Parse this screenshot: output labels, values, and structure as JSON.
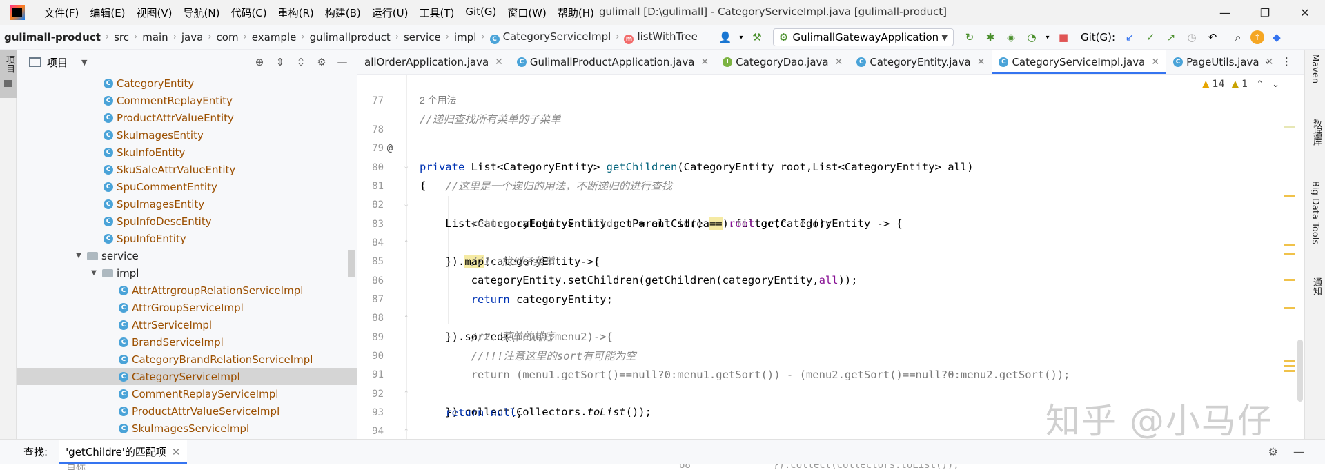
{
  "titlebar": {
    "menu": [
      "文件(F)",
      "编辑(E)",
      "视图(V)",
      "导航(N)",
      "代码(C)",
      "重构(R)",
      "构建(B)",
      "运行(U)",
      "工具(T)",
      "Git(G)",
      "窗口(W)",
      "帮助(H)"
    ],
    "window_title": "gulimall [D:\\gulimall] - CategoryServiceImpl.java [gulimall-product]",
    "minimize": "—",
    "maximize": "❐",
    "close": "✕"
  },
  "navbar": {
    "breadcrumbs": [
      "gulimall-product",
      "src",
      "main",
      "java",
      "com",
      "example",
      "gulimallproduct",
      "service",
      "impl",
      "CategoryServiceImpl",
      "listWithTree"
    ],
    "run_config": "GulimallGatewayApplication",
    "git_label": "Git(G):"
  },
  "left_strip": {
    "project_tab": "项目"
  },
  "project_panel": {
    "title": "项目",
    "tree": [
      {
        "label": "CategoryEntity",
        "type": "class",
        "indent": 3
      },
      {
        "label": "CommentReplayEntity",
        "type": "class",
        "indent": 3
      },
      {
        "label": "ProductAttrValueEntity",
        "type": "class",
        "indent": 3
      },
      {
        "label": "SkuImagesEntity",
        "type": "class",
        "indent": 3
      },
      {
        "label": "SkuInfoEntity",
        "type": "class",
        "indent": 3
      },
      {
        "label": "SkuSaleAttrValueEntity",
        "type": "class",
        "indent": 3
      },
      {
        "label": "SpuCommentEntity",
        "type": "class",
        "indent": 3
      },
      {
        "label": "SpuImagesEntity",
        "type": "class",
        "indent": 3
      },
      {
        "label": "SpuInfoDescEntity",
        "type": "class",
        "indent": 3
      },
      {
        "label": "SpuInfoEntity",
        "type": "class",
        "indent": 3
      },
      {
        "label": "service",
        "type": "package",
        "indent": 2
      },
      {
        "label": "impl",
        "type": "package",
        "indent": 3
      },
      {
        "label": "AttrAttrgroupRelationServiceImpl",
        "type": "class",
        "indent": 4
      },
      {
        "label": "AttrGroupServiceImpl",
        "type": "class",
        "indent": 4
      },
      {
        "label": "AttrServiceImpl",
        "type": "class",
        "indent": 4
      },
      {
        "label": "BrandServiceImpl",
        "type": "class",
        "indent": 4
      },
      {
        "label": "CategoryBrandRelationServiceImpl",
        "type": "class",
        "indent": 4
      },
      {
        "label": "CategoryServiceImpl",
        "type": "class",
        "indent": 4,
        "selected": true
      },
      {
        "label": "CommentReplayServiceImpl",
        "type": "class",
        "indent": 4
      },
      {
        "label": "ProductAttrValueServiceImpl",
        "type": "class",
        "indent": 4
      },
      {
        "label": "SkuImagesServiceImpl",
        "type": "class",
        "indent": 4
      }
    ]
  },
  "editor_tabs": [
    {
      "label": "allOrderApplication.java",
      "icon": "none"
    },
    {
      "label": "GulimallProductApplication.java",
      "icon": "class"
    },
    {
      "label": "CategoryDao.java",
      "icon": "interface"
    },
    {
      "label": "CategoryEntity.java",
      "icon": "class"
    },
    {
      "label": "CategoryServiceImpl.java",
      "icon": "class",
      "active": true
    },
    {
      "label": "PageUtils.java",
      "icon": "class"
    }
  ],
  "inspections": {
    "warnings": "14",
    "weak_warnings": "1"
  },
  "editor": {
    "usage_hint": "2 个用法",
    "line_numbers": [
      "77",
      "78",
      "79",
      "80",
      "81",
      "82",
      "83",
      "84",
      "85",
      "86",
      "87",
      "88",
      "89",
      "90",
      "91",
      "92",
      "93",
      "94"
    ]
  },
  "right_strip": [
    "Maven",
    "数据库",
    "Big Data Tools",
    "通知"
  ],
  "findbar": {
    "label": "查找:",
    "tab": "'getChildre'的匹配项"
  },
  "bottom_peek": {
    "text": "68",
    "code": "}).collect(Collectors.toList());",
    "left": "目标"
  },
  "watermark": "知乎 @小马仔",
  "colors": {
    "accent": "#3574f0",
    "keyword": "#0033b3",
    "method": "#00627a",
    "comment": "#8c8c8c",
    "class_label": "#9b4f00"
  }
}
